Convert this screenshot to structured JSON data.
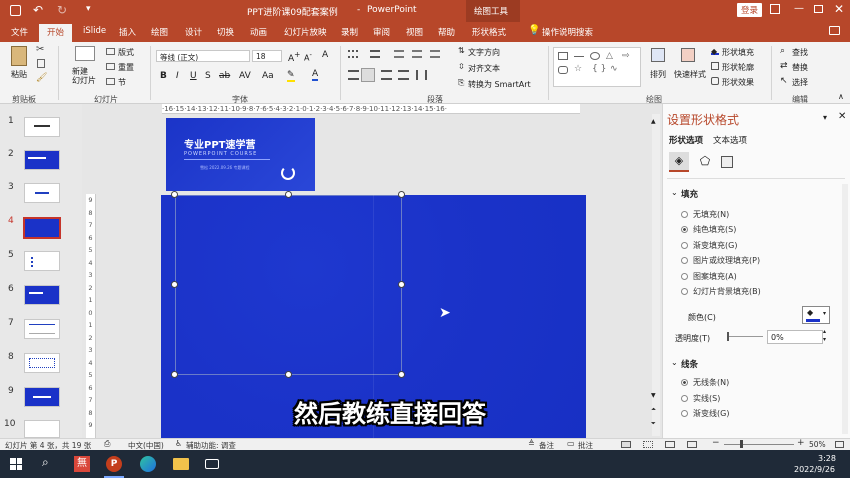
{
  "titlebar": {
    "doc_title": "PPT进阶课09配套案例",
    "sep": "-",
    "app": "PowerPoint",
    "context_tools": "绘图工具",
    "login_label": "登录"
  },
  "menu": [
    "文件",
    "开始",
    "iSlide",
    "插入",
    "绘图",
    "设计",
    "切换",
    "动画",
    "幻灯片放映",
    "录制",
    "审阅",
    "视图",
    "帮助",
    "形状格式"
  ],
  "tell_me": "操作说明搜索",
  "ribbon": {
    "paste": "粘贴",
    "new_slide": "新建\n幻灯片",
    "layout": "版式",
    "reset": "重置",
    "section": "节",
    "font_name": "等线 (正文)",
    "font_size": "18",
    "text_direction": "文字方向",
    "align_text": "对齐文本",
    "smartart": "转换为 SmartArt",
    "arrange": "排列",
    "quick_styles": "快速样式",
    "shape_fill": "形状填充",
    "shape_outline": "形状轮廓",
    "shape_effects": "形状效果",
    "find": "查找",
    "replace": "替换",
    "select": "选择",
    "groups": [
      "剪贴板",
      "幻灯片",
      "字体",
      "段落",
      "绘图",
      "编辑"
    ]
  },
  "ruler_h": "·16·15·14·13·12·11·10·9·8·7·6·5·4·3·2·1·0·1·2·3·4·5·6·7·8·9·10·11·12·13·14·15·16·",
  "ruler_v": [
    "9",
    "8",
    "7",
    "6",
    "5",
    "4",
    "3",
    "2",
    "1",
    "0",
    "1",
    "2",
    "3",
    "4",
    "5",
    "6",
    "7",
    "8",
    "9"
  ],
  "thumbnails": {
    "numbers": [
      "1",
      "2",
      "3",
      "4",
      "5",
      "6",
      "7",
      "8",
      "9",
      "10"
    ],
    "selected_index": 4
  },
  "slide1": {
    "title": "专业PPT速学营",
    "subtitle": "POWERPOINT COURSE",
    "small": "雪松 2022.09.26 专题课程"
  },
  "caption": "然后教练直接回答",
  "pane": {
    "title": "设置形状格式",
    "tab_shape": "形状选项",
    "tab_text": "文本选项",
    "fill_header": "填充",
    "fill_options": [
      "无填充(N)",
      "纯色填充(S)",
      "渐变填充(G)",
      "图片或纹理填充(P)",
      "图案填充(A)",
      "幻灯片背景填充(B)"
    ],
    "fill_selected": 1,
    "color_label": "颜色(C)",
    "transparency_label": "透明度(T)",
    "transparency_value": "0%",
    "line_header": "线条",
    "line_options": [
      "无线条(N)",
      "实线(S)",
      "渐变线(G)"
    ],
    "line_selected": 0
  },
  "status": {
    "slide_info": "幻灯片 第 4 张，共 19 张",
    "language": "中文(中国)",
    "accessibility": "辅助功能: 调查",
    "notes": "备注",
    "comments": "批注",
    "zoom": "50%"
  },
  "taskbar": {
    "time": "3:28",
    "date": "2022/9/26",
    "wps_label": "無"
  },
  "colors": {
    "accent": "#b7472a",
    "slide_blue": "#1a32c8",
    "selection": "#c5342a"
  }
}
